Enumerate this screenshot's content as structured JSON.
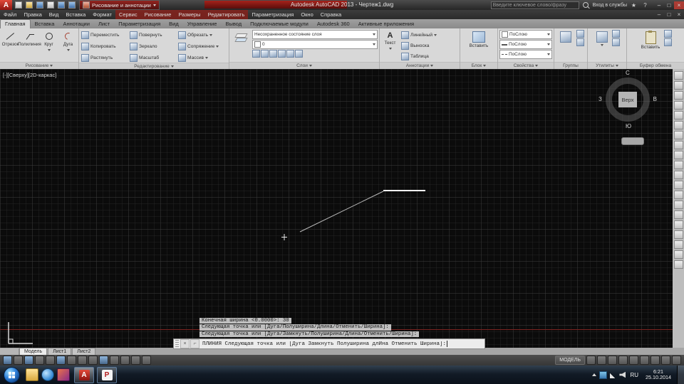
{
  "window": {
    "title": "Autodesk AutoCAD 2013 - Чертеж1.dwg",
    "controls": {
      "min": "–",
      "max": "□",
      "close": "×"
    }
  },
  "quick_access": {
    "workspace": "Рисование и аннотации"
  },
  "infocenter": {
    "search_placeholder": "Введите ключевое слово/фразу",
    "signin": "Вход в службы",
    "star": "★",
    "help": "?"
  },
  "menu": {
    "items": [
      "Файл",
      "Правка",
      "Вид",
      "Вставка",
      "Формат",
      "Сервис",
      "Рисование",
      "Размеры",
      "Редактировать",
      "Параметризация",
      "Окно",
      "Справка"
    ]
  },
  "ribbon": {
    "tabs": [
      "Главная",
      "Вставка",
      "Аннотации",
      "Лист",
      "Параметризация",
      "Вид",
      "Управление",
      "Вывод",
      "Подключаемые модули",
      "Autodesk 360",
      "Активные приложения"
    ],
    "panels": {
      "draw": {
        "label": "Рисование",
        "buttons": [
          "Отрезок",
          "Полилиния",
          "Круг",
          "Дуга"
        ]
      },
      "modify": {
        "label": "Редактирование",
        "buttons": [
          "Переместить",
          "Повернуть",
          "Обрезать",
          "Копировать",
          "Зеркало",
          "Сопряжение",
          "Растянуть",
          "Масштаб",
          "Массив"
        ]
      },
      "layers": {
        "label": "Слои",
        "state": "Несохраненное состояние слоя",
        "layer": "0"
      },
      "annotate": {
        "label": "Аннотации",
        "text": "Текст",
        "text_glyph": "А",
        "dim": "Линейный",
        "leader": "Выноска",
        "table": "Таблица"
      },
      "block": {
        "label": "Блок",
        "insert": "Вставить"
      },
      "props": {
        "label": "Свойства",
        "bylayer": "ПоСлою"
      },
      "groups": {
        "label": "Группы"
      },
      "utils": {
        "label": "Утилиты"
      },
      "clipboard": {
        "label": "Буфер обмена",
        "paste": "Вставить"
      }
    }
  },
  "canvas": {
    "viewport_label": "[-][Сверху][2D-каркас]",
    "viewcube": {
      "n": "С",
      "e": "В",
      "s": "Ю",
      "w": "З",
      "face": "Верх"
    }
  },
  "command": {
    "history": [
      "Конечная ширина <0.0000>: 30",
      "Следующая точка или [Дуга/Полуширина/Длина/Отменить/Ширина]:",
      "Следующая точка или [Дуга/Замкнуть/Полуширина/Длина/Отменить/Ширина]:"
    ],
    "prompt": "ПЛИНИЯ Следующая точка или [Дуга Замкнуть Полуширина длИна Отменить Ширина]:"
  },
  "status": {
    "tabs": [
      "Модель",
      "Лист1",
      "Лист2"
    ],
    "model_label": "МОДЕЛЬ"
  },
  "taskbar": {
    "apps": {
      "autocad": "A",
      "p": "Р"
    },
    "lang": "RU",
    "time": "6:21",
    "date": "25.10.2014"
  }
}
